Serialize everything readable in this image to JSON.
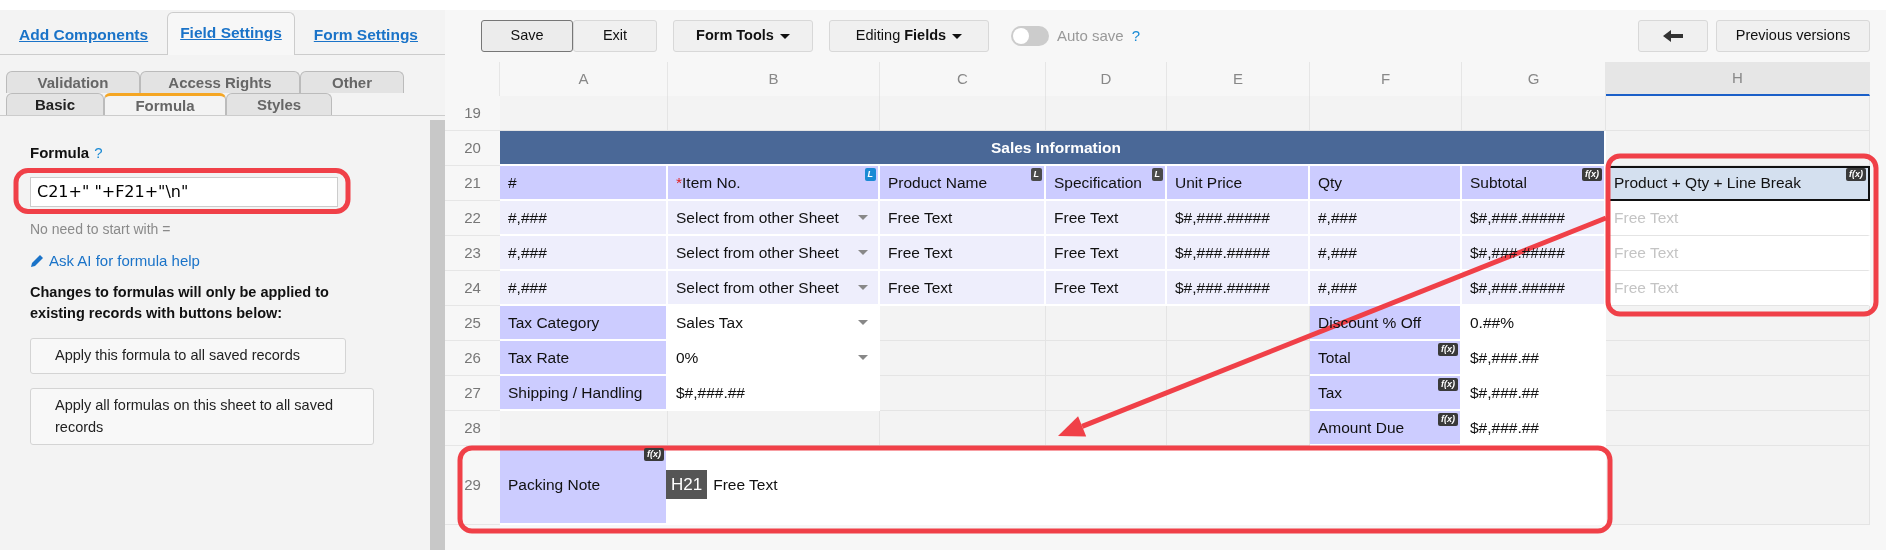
{
  "left_panel": {
    "main_tabs": [
      {
        "label": "Add Components",
        "selected": false
      },
      {
        "label": "Field Settings",
        "selected": true
      },
      {
        "label": "Form Settings",
        "selected": false
      }
    ],
    "sub_tab_rows": [
      {
        "tabs": [
          {
            "label": "Validation",
            "selected": false
          },
          {
            "label": "Access Rights",
            "selected": false
          },
          {
            "label": "Other",
            "selected": false
          }
        ]
      },
      {
        "tabs": [
          {
            "label": "Basic",
            "selected": false
          },
          {
            "label": "Formula",
            "selected": true
          },
          {
            "label": "Styles",
            "selected": false
          }
        ]
      }
    ],
    "formula": {
      "label": "Formula",
      "help": "?",
      "value": "C21+\" \"+F21+\"\\n\"",
      "hint": "No need to start with ="
    },
    "ai_link": "Ask AI for formula help",
    "notice": "Changes to formulas will only be applied to existing records with buttons below:",
    "buttons": [
      "Apply this formula to all saved records",
      "Apply all formulas on this sheet to all saved records"
    ]
  },
  "toolbar": {
    "buttons": [
      {
        "label": "Save",
        "focused": true
      },
      {
        "label": "Exit",
        "focused": false
      }
    ],
    "menus": [
      {
        "label": "**Form Tools**"
      },
      {
        "label": "Editing **Fields**"
      }
    ],
    "autosave": {
      "label": "Auto save",
      "on": false,
      "help": "?"
    },
    "versions_button": "Previous versions"
  },
  "sheet": {
    "columns": [
      {
        "label": "A",
        "selected": false
      },
      {
        "label": "B",
        "selected": false
      },
      {
        "label": "C",
        "selected": false
      },
      {
        "label": "D",
        "selected": false
      },
      {
        "label": "E",
        "selected": false
      },
      {
        "label": "F",
        "selected": false
      },
      {
        "label": "G",
        "selected": false
      },
      {
        "label": "H",
        "selected": true
      }
    ],
    "rows": [
      {
        "number": "19",
        "cells": [
          {
            "kind": "empty"
          },
          {
            "kind": "empty"
          },
          {
            "kind": "empty"
          },
          {
            "kind": "empty"
          },
          {
            "kind": "empty"
          },
          {
            "kind": "empty"
          },
          {
            "kind": "empty"
          },
          {
            "kind": "empty"
          }
        ]
      },
      {
        "number": "20",
        "title": "Sales Information"
      },
      {
        "number": "21",
        "cells": [
          {
            "kind": "label",
            "text": "#"
          },
          {
            "kind": "label",
            "required_mark": "*",
            "text": "Item No.",
            "badge": {
              "text": "L",
              "color": "#1a8ad4"
            }
          },
          {
            "kind": "label",
            "text": "Product Name",
            "badge": {
              "text": "L",
              "color": "#4a4a4a"
            }
          },
          {
            "kind": "label",
            "text": "Specification",
            "badge": {
              "text": "L",
              "color": "#4a4a4a"
            }
          },
          {
            "kind": "label",
            "text": "Unit Price"
          },
          {
            "kind": "label",
            "text": "Qty"
          },
          {
            "kind": "label",
            "text": "Subtotal",
            "badge": {
              "text": "f(x)",
              "color": "#3a3a3a"
            }
          },
          {
            "kind": "current",
            "text": "Product + Qty + Line Break",
            "badge": {
              "text": "f(x)",
              "color": "#3a3a3a"
            }
          }
        ]
      },
      {
        "number": "22",
        "cells": [
          {
            "kind": "value",
            "text": "#,###"
          },
          {
            "kind": "select_shaded",
            "text": "Select from other Sheet"
          },
          {
            "kind": "value",
            "text": "Free Text"
          },
          {
            "kind": "value",
            "text": "Free Text"
          },
          {
            "kind": "value",
            "text": "$#,###.#####"
          },
          {
            "kind": "value",
            "text": "#,###"
          },
          {
            "kind": "value",
            "text": "$#,###.#####"
          },
          {
            "kind": "muted",
            "text": "Free Text"
          }
        ]
      },
      {
        "number": "23",
        "cells": [
          {
            "kind": "value",
            "text": "#,###"
          },
          {
            "kind": "select_shaded",
            "text": "Select from other Sheet"
          },
          {
            "kind": "value",
            "text": "Free Text"
          },
          {
            "kind": "value",
            "text": "Free Text"
          },
          {
            "kind": "value",
            "text": "$#,###.#####"
          },
          {
            "kind": "value",
            "text": "#,###"
          },
          {
            "kind": "value",
            "text": "$#,###.#####"
          },
          {
            "kind": "muted",
            "text": "Free Text"
          }
        ]
      },
      {
        "number": "24",
        "cells": [
          {
            "kind": "value",
            "text": "#,###"
          },
          {
            "kind": "select_shaded",
            "text": "Select from other Sheet"
          },
          {
            "kind": "value",
            "text": "Free Text"
          },
          {
            "kind": "value",
            "text": "Free Text"
          },
          {
            "kind": "value",
            "text": "$#,###.#####"
          },
          {
            "kind": "value",
            "text": "#,###"
          },
          {
            "kind": "value",
            "text": "$#,###.#####"
          },
          {
            "kind": "muted",
            "text": "Free Text"
          }
        ]
      },
      {
        "number": "25",
        "cells": [
          {
            "kind": "label",
            "text": "Tax Category"
          },
          {
            "kind": "select",
            "text": "Sales Tax"
          },
          {
            "kind": "empty"
          },
          {
            "kind": "empty"
          },
          {
            "kind": "empty"
          },
          {
            "kind": "label",
            "text": "Discount % Off"
          },
          {
            "kind": "input",
            "text": "0.##%"
          },
          {
            "kind": "empty"
          }
        ]
      },
      {
        "number": "26",
        "cells": [
          {
            "kind": "label",
            "text": "Tax Rate"
          },
          {
            "kind": "select",
            "text": "0%"
          },
          {
            "kind": "empty"
          },
          {
            "kind": "empty"
          },
          {
            "kind": "empty"
          },
          {
            "kind": "label",
            "text": "Total",
            "badge": {
              "text": "f(x)",
              "color": "#3a3a3a"
            }
          },
          {
            "kind": "input",
            "text": "$#,###.##"
          },
          {
            "kind": "empty"
          }
        ]
      },
      {
        "number": "27",
        "cells": [
          {
            "kind": "label",
            "text": "Shipping / Handling"
          },
          {
            "kind": "input",
            "text": "$#,###.##"
          },
          {
            "kind": "empty"
          },
          {
            "kind": "empty"
          },
          {
            "kind": "empty"
          },
          {
            "kind": "label",
            "text": "Tax",
            "badge": {
              "text": "f(x)",
              "color": "#3a3a3a"
            }
          },
          {
            "kind": "input",
            "text": "$#,###.##"
          },
          {
            "kind": "empty"
          }
        ]
      },
      {
        "number": "28",
        "cells": [
          {
            "kind": "empty"
          },
          {
            "kind": "empty"
          },
          {
            "kind": "empty"
          },
          {
            "kind": "empty"
          },
          {
            "kind": "empty"
          },
          {
            "kind": "label",
            "text": "Amount Due",
            "badge": {
              "text": "f(x)",
              "color": "#3a3a3a"
            }
          },
          {
            "kind": "input",
            "text": "$#,###.##"
          },
          {
            "kind": "empty"
          }
        ]
      },
      {
        "number": "29",
        "cells": [
          {
            "kind": "label",
            "text": "Packing Note",
            "badge": {
              "text": "f(x)",
              "color": "#3a3a3a"
            }
          },
          {
            "kind": "note",
            "text": "Free Text",
            "tooltip": "H21"
          },
          {
            "kind": "empty"
          }
        ]
      }
    ]
  },
  "annotations": [
    {
      "kind": "frame"
    },
    {
      "kind": "frame"
    },
    {
      "kind": "frame"
    },
    {
      "kind": "arrow"
    }
  ]
}
